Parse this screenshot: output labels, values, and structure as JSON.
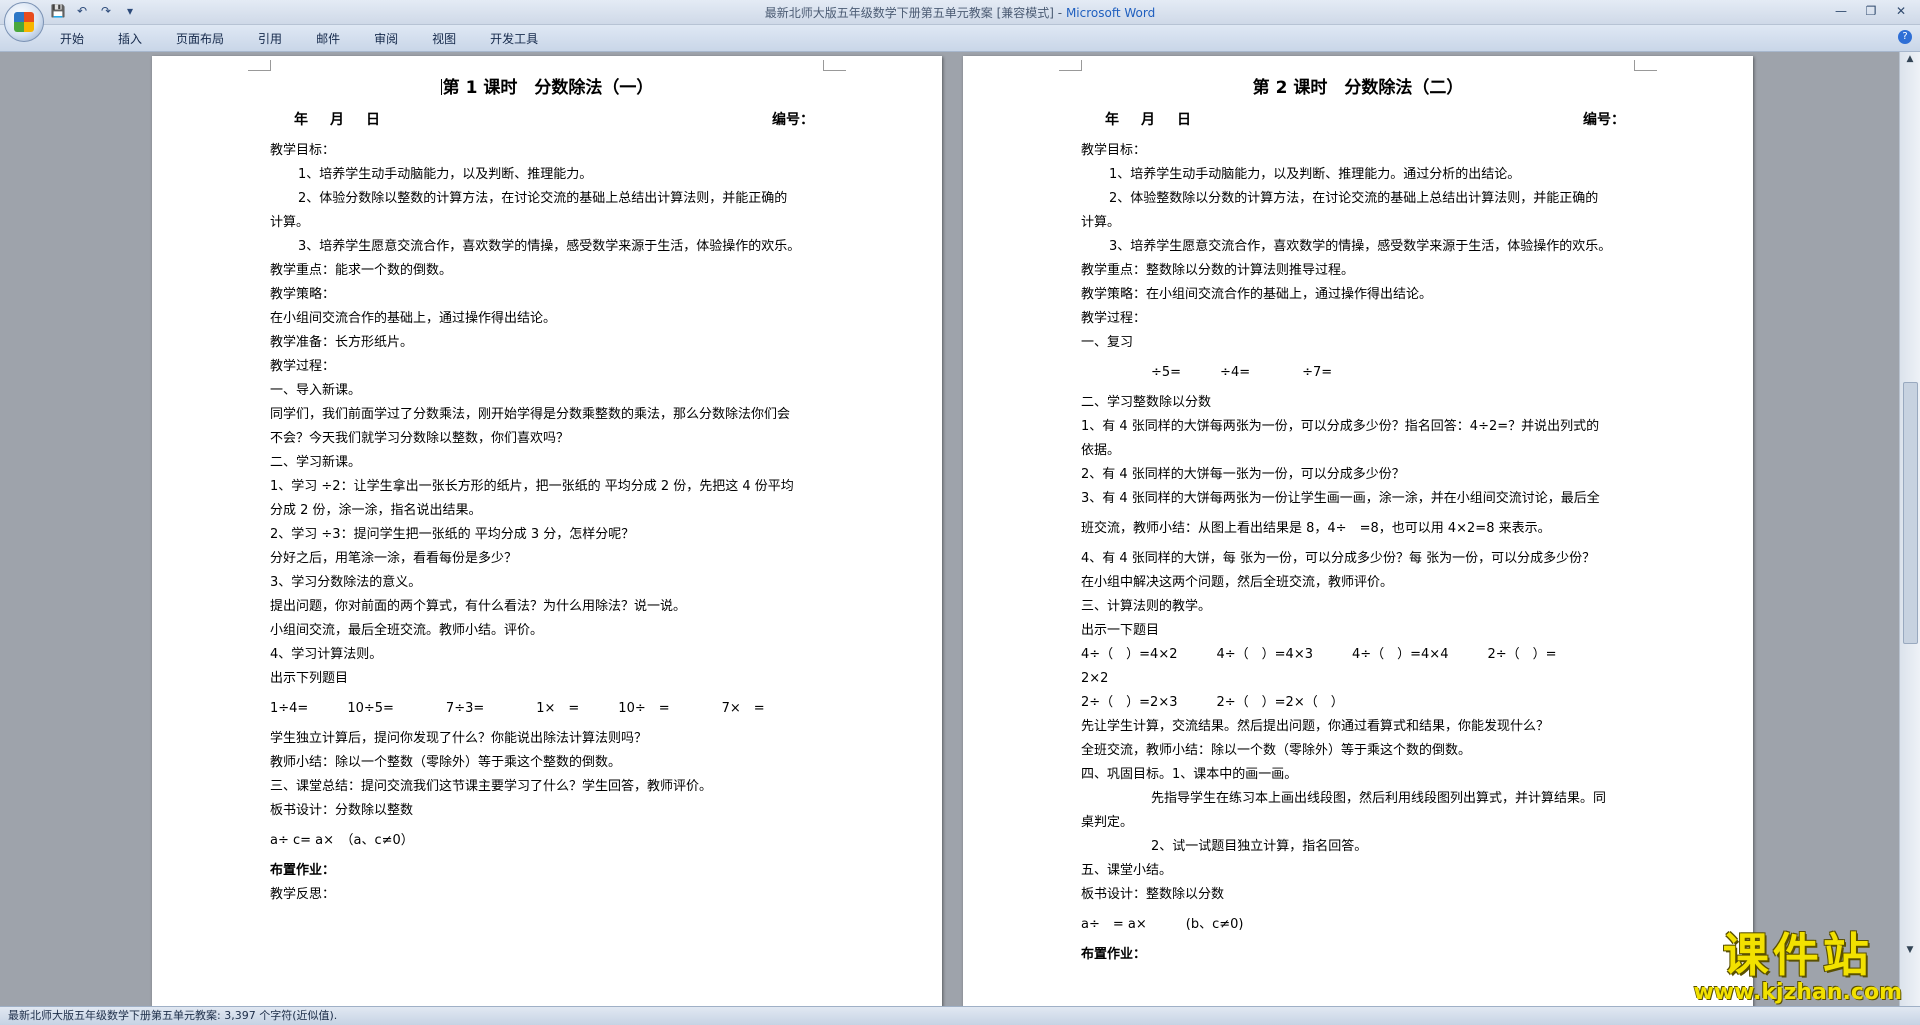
{
  "window": {
    "title": "最新北师大版五年级数学下册第五单元教案 [兼容模式]",
    "app_name": "Microsoft Word",
    "title_sep": " - "
  },
  "ribbon": {
    "tabs": [
      "开始",
      "插入",
      "页面布局",
      "引用",
      "邮件",
      "审阅",
      "视图",
      "开发工具"
    ]
  },
  "page_left": {
    "title": "第 1 课时　分数除法（一）",
    "date_label": "年　月　日",
    "number_label": "编号：",
    "lines": [
      "教学目标：",
      "1、培养学生动手动脑能力，以及判断、推理能力。",
      "2、体验分数除以整数的计算方法，在讨论交流的基础上总结出计算法则，并能正确的",
      "计算。",
      "3、培养学生愿意交流合作，喜欢数学的情操，感受数学来源于生活，体验操作的欢乐。",
      "教学重点：能求一个数的倒数。",
      "教学策略：",
      "在小组间交流合作的基础上，通过操作得出结论。",
      "教学准备：长方形纸片。",
      "教学过程：",
      "一、导入新课。",
      "同学们，我们前面学过了分数乘法，刚开始学得是分数乘整数的乘法，那么分数除法你们会",
      "不会？今天我们就学习分数除以整数，你们喜欢吗？",
      "二、学习新课。",
      "1、学习  ÷2：让学生拿出一张长方形的纸片，把一张纸的  平均分成 2 份，先把这 4 份平均",
      "分成 2 份，涂一涂，指名说出结果。",
      "2、学习  ÷3：提问学生把一张纸的  平均分成 3 分，怎样分呢？",
      "分好之后，用笔涂一涂，看看每份是多少？",
      "3、学习分数除法的意义。",
      "提出问题，你对前面的两个算式，有什么看法？为什么用除法？说一说。",
      "小组间交流，最后全班交流。教师小结。评价。",
      "4、学习计算法则。",
      "出示下列题目",
      "1÷4=　　　10÷5=　　　　7÷3=　　　　1×　=　　　10÷　=　　　　7×　=",
      "学生独立计算后，提问你发现了什么？你能说出除法计算法则吗？",
      "教师小结：除以一个整数（零除外）等于乘这个整数的倒数。",
      "三、课堂总结：提问交流我们这节课主要学习了什么？学生回答，教师评价。",
      "板书设计：分数除以整数",
      "a÷ c= a×　（a、c≠0）",
      "布置作业：",
      "",
      "教学反思："
    ]
  },
  "page_right": {
    "title": "第 2 课时　分数除法（二）",
    "date_label": "年　月　日",
    "number_label": "编号：",
    "lines": [
      "教学目标：",
      "1、培养学生动手动脑能力，以及判断、推理能力。通过分析的出结论。",
      "2、体验整数除以分数的计算方法，在讨论交流的基础上总结出计算法则，并能正确的",
      "计算。",
      "3、培养学生愿意交流合作，喜欢数学的情操，感受数学来源于生活，体验操作的欢乐。",
      "教学重点：整数除以分数的计算法则推导过程。",
      "教学策略：在小组间交流合作的基础上，通过操作得出结论。",
      "教学过程：",
      "一、复习",
      "÷5=　　　÷4=　　　　÷7=",
      "二、学习整数除以分数",
      "1、有 4 张同样的大饼每两张为一份，可以分成多少份？指名回答：4÷2=？并说出列式的",
      "依据。",
      "2、有 4 张同样的大饼每一张为一份，可以分成多少份？",
      "3、有 4 张同样的大饼每两张为一份让学生画一画，涂一涂，并在小组间交流讨论，最后全",
      "班交流，教师小结：从图上看出结果是 8，4÷　=8，也可以用 4×2=8 来表示。",
      "4、有 4 张同样的大饼，每  张为一份，可以分成多少份？每  张为一份，可以分成多少份？",
      "在小组中解决这两个问题，然后全班交流，教师评价。",
      "三、计算法则的教学。",
      "出示一下题目",
      "4÷（　）=4×2　　　4÷（　）=4×3　　　4÷（　）=4×4　　　2÷（　）=",
      "2×2",
      "2÷（　）=2×3　　　2÷（　）=2×（　）",
      "先让学生计算，交流结果。然后提出问题，你通过看算式和结果，你能发现什么？",
      "全班交流，教师小结：除以一个数（零除外）等于乘这个数的倒数。",
      "四、巩固目标。1、课本中的画一画。",
      "先指导学生在练习本上画出线段图，然后利用线段图列出算式，并计算结果。同",
      "桌判定。",
      "2、试一试题目独立计算，指名回答。",
      "五、课堂小结。",
      "板书设计：整数除以分数",
      "a÷　= a×　　　(b、c≠0)",
      "布置作业："
    ]
  },
  "statusbar": {
    "text": "最新北师大版五年级数学下册第五单元教案: 3,397 个字符(近似值)."
  },
  "watermark": {
    "cn": "课件站",
    "url": "www.kjzhan.com"
  }
}
